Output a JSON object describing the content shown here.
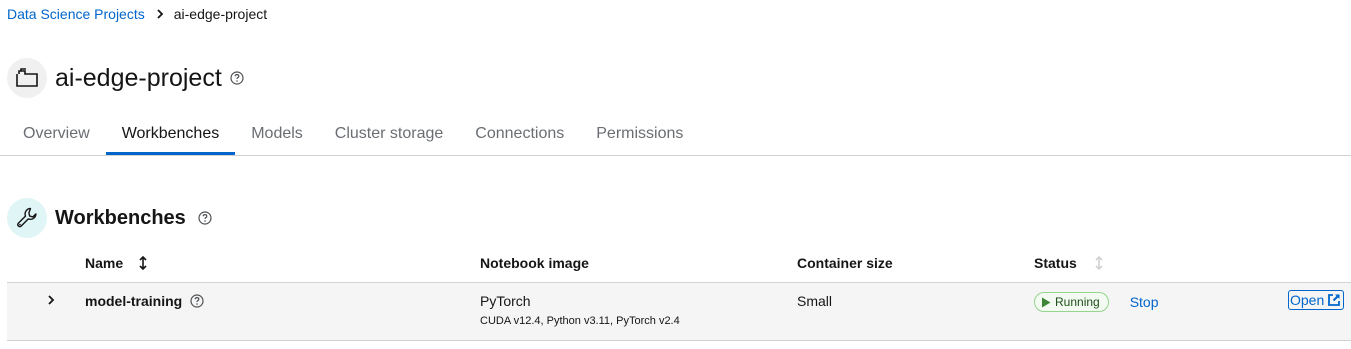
{
  "breadcrumb": {
    "parent": "Data Science Projects",
    "current": "ai-edge-project"
  },
  "project": {
    "title": "ai-edge-project"
  },
  "tabs": [
    {
      "label": "Overview"
    },
    {
      "label": "Workbenches"
    },
    {
      "label": "Models"
    },
    {
      "label": "Cluster storage"
    },
    {
      "label": "Connections"
    },
    {
      "label": "Permissions"
    }
  ],
  "active_tab": "Workbenches",
  "section": {
    "title": "Workbenches"
  },
  "table": {
    "headers": {
      "name": "Name",
      "notebook_image": "Notebook image",
      "container_size": "Container size",
      "status": "Status"
    },
    "rows": [
      {
        "name": "model-training",
        "image": "PyTorch",
        "image_detail": "CUDA v12.4, Python v3.11, PyTorch v2.4",
        "size": "Small",
        "status": "Running",
        "stop_label": "Stop",
        "open_label": "Open"
      }
    ]
  },
  "colors": {
    "link": "#0066cc",
    "running_badge_bg": "#f3faf2",
    "running_badge_border": "#95d58e",
    "running_icon": "#3e8635"
  },
  "icons": {
    "project": "folder-project-icon",
    "help": "help-icon",
    "wrench": "wrench-icon",
    "sort": "sort-icon",
    "expand": "chevron-right-icon",
    "play": "play-icon",
    "external_link": "external-link-icon"
  }
}
